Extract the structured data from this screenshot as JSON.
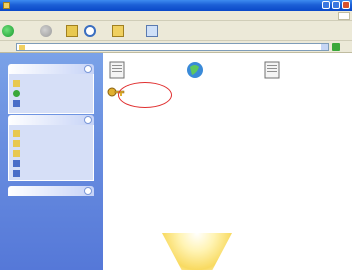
{
  "window": {
    "title": "",
    "controls": {
      "minimize": "",
      "maximize": "",
      "close": ""
    }
  },
  "menubar": {
    "items": [
      "",
      "",
      "",
      "",
      "",
      ""
    ]
  },
  "toolbar": {
    "back_label": "",
    "search_label": "",
    "folders_label": ""
  },
  "address": {
    "value": ""
  },
  "task_panels": [
    {
      "title": "",
      "tasks": [
        "",
        "",
        ""
      ]
    },
    {
      "title": "",
      "tasks": [
        "",
        "",
        "",
        "",
        ""
      ]
    },
    {
      "title": "",
      "tasks": []
    }
  ],
  "files": [
    {
      "name": "",
      "desc": "",
      "icon": "document-icon"
    },
    {
      "name": "",
      "desc": "",
      "icon": "globe-icon"
    },
    {
      "name": "",
      "desc": "",
      "icon": "document-icon"
    },
    {
      "name": "",
      "desc": "",
      "icon": "key-icon"
    }
  ],
  "colors": {
    "titlebar": "#0a48c8",
    "taskpane": "#6a8fe0",
    "highlight_ring": "#e03030"
  }
}
